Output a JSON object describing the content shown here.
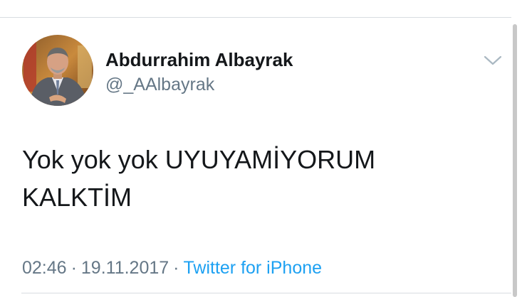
{
  "tweet": {
    "author": {
      "display_name": "Abdurrahim Albayrak",
      "handle": "@_AAlbayrak"
    },
    "text_lines": [
      "Yok yok yok UYUYAMİYORUM",
      "KALKTİM"
    ],
    "time": "02:46",
    "date": "19.11.2017",
    "separator": "·",
    "source": "Twitter for iPhone",
    "menu_icon": "chevron-down-icon"
  },
  "colors": {
    "text_primary": "#14171a",
    "text_secondary": "#657786",
    "link": "#1da1f2",
    "divider": "#d8dde1"
  }
}
